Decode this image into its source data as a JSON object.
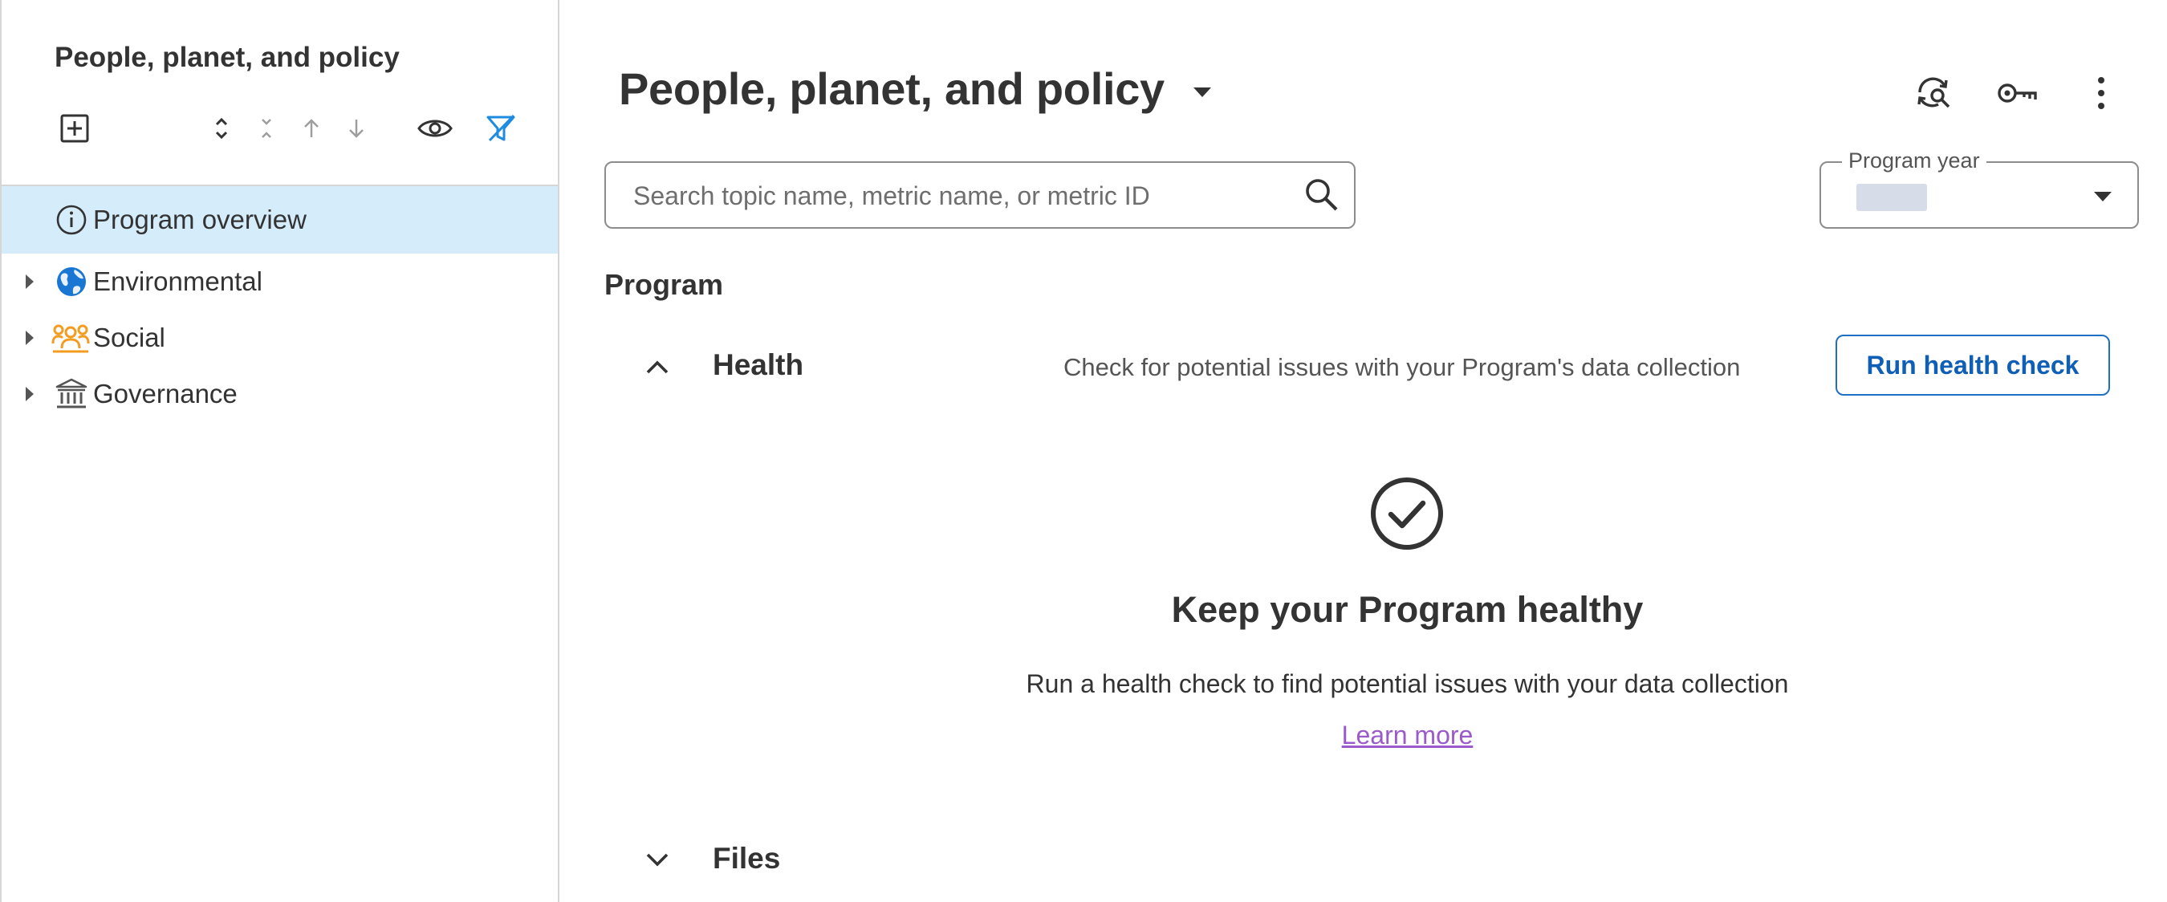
{
  "sidebar": {
    "title": "People, planet, and policy",
    "items": [
      {
        "label": "Program overview",
        "icon": "info-circle-icon",
        "selected": true
      },
      {
        "label": "Environmental",
        "icon": "globe-icon",
        "expandable": true
      },
      {
        "label": "Social",
        "icon": "people-group-icon",
        "expandable": true
      },
      {
        "label": "Governance",
        "icon": "bank-building-icon",
        "expandable": true
      }
    ]
  },
  "header": {
    "title": "People, planet, and policy"
  },
  "search": {
    "placeholder": "Search topic name, metric name, or metric ID",
    "value": ""
  },
  "program_year": {
    "label": "Program year"
  },
  "program": {
    "heading": "Program",
    "health": {
      "title": "Health",
      "description": "Check for potential issues with your Program's data collection",
      "button_label": "Run health check",
      "empty_title": "Keep your Program healthy",
      "empty_description": "Run a health check to find potential issues with your data collection",
      "learn_more": "Learn more"
    },
    "files": {
      "title": "Files"
    }
  },
  "colors": {
    "selected_bg": "#d5ecfb",
    "accent_blue": "#1f6fc5",
    "link_purple": "#9b5ac9",
    "social_orange": "#f39c1f",
    "globe_blue": "#1976d2"
  }
}
